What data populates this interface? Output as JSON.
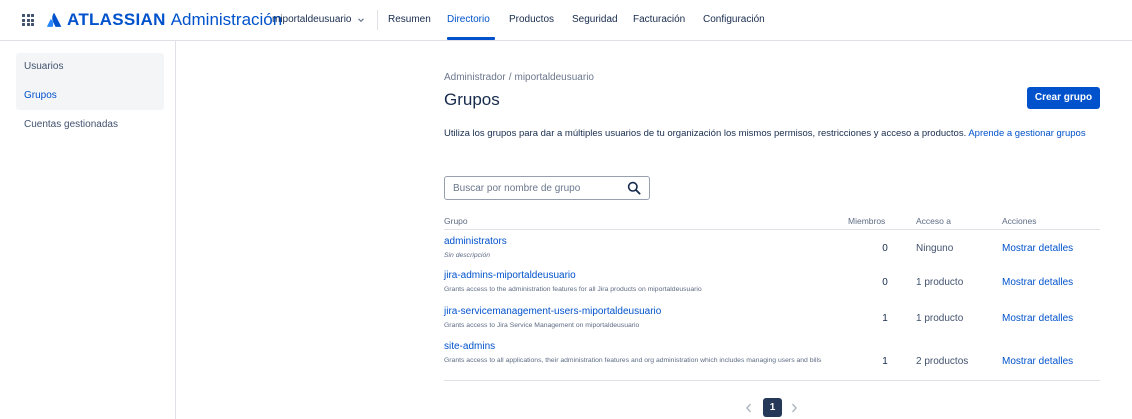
{
  "header": {
    "brand": "ATLASSIAN",
    "product": "Administración",
    "org": "miportaldeusuario",
    "nav": [
      "Resumen",
      "Directorio",
      "Productos",
      "Seguridad",
      "Facturación",
      "Configuración"
    ],
    "active_nav": "Directorio"
  },
  "sidebar": {
    "items": [
      {
        "label": "Usuarios"
      },
      {
        "label": "Grupos"
      },
      {
        "label": "Cuentas gestionadas"
      }
    ],
    "active": "Grupos"
  },
  "main": {
    "breadcrumb": [
      "Administrador",
      "miportaldeusuario"
    ],
    "breadcrumb_sep": "/",
    "title": "Grupos",
    "create_button": "Crear grupo",
    "description": "Utiliza los grupos para dar a múltiples usuarios de tu organización los mismos permisos, restricciones y acceso a productos.",
    "description_link": "Aprende a gestionar grupos",
    "search_placeholder": "Buscar por nombre de grupo"
  },
  "table": {
    "headers": {
      "group": "Grupo",
      "members": "Miembros",
      "access": "Acceso a",
      "actions": "Acciones"
    },
    "rows": [
      {
        "name": "administrators",
        "description": "Sin descripción",
        "members": "0",
        "access": "Ninguno",
        "action": "Mostrar detalles"
      },
      {
        "name": "jira-admins-miportaldeusuario",
        "description": "Grants access to the administration features for all Jira products on miportaldeusuario",
        "members": "0",
        "access": "1 producto",
        "action": "Mostrar detalles"
      },
      {
        "name": "jira-servicemanagement-users-miportaldeusuario",
        "description": "Grants access to Jira Service Management on miportaldeusuario",
        "members": "1",
        "access": "1 producto",
        "action": "Mostrar detalles"
      },
      {
        "name": "site-admins",
        "description": "Grants access to all applications, their administration features and org administration which includes managing users and bills",
        "members": "1",
        "access": "2 productos",
        "action": "Mostrar detalles"
      }
    ]
  },
  "pagination": {
    "current": "1"
  },
  "colors": {
    "accent": "#0052cc",
    "text": "#172b4d",
    "muted": "#5e6c84",
    "sidebar_bg": "#f4f5f7",
    "page_badge": "#253858"
  },
  "icons": {
    "app_switcher": "grid-icon",
    "logo": "atlassian-logo-icon",
    "org_dropdown": "chevron-down-icon",
    "search": "search-icon",
    "prev": "chevron-left-icon",
    "next": "chevron-right-icon"
  }
}
